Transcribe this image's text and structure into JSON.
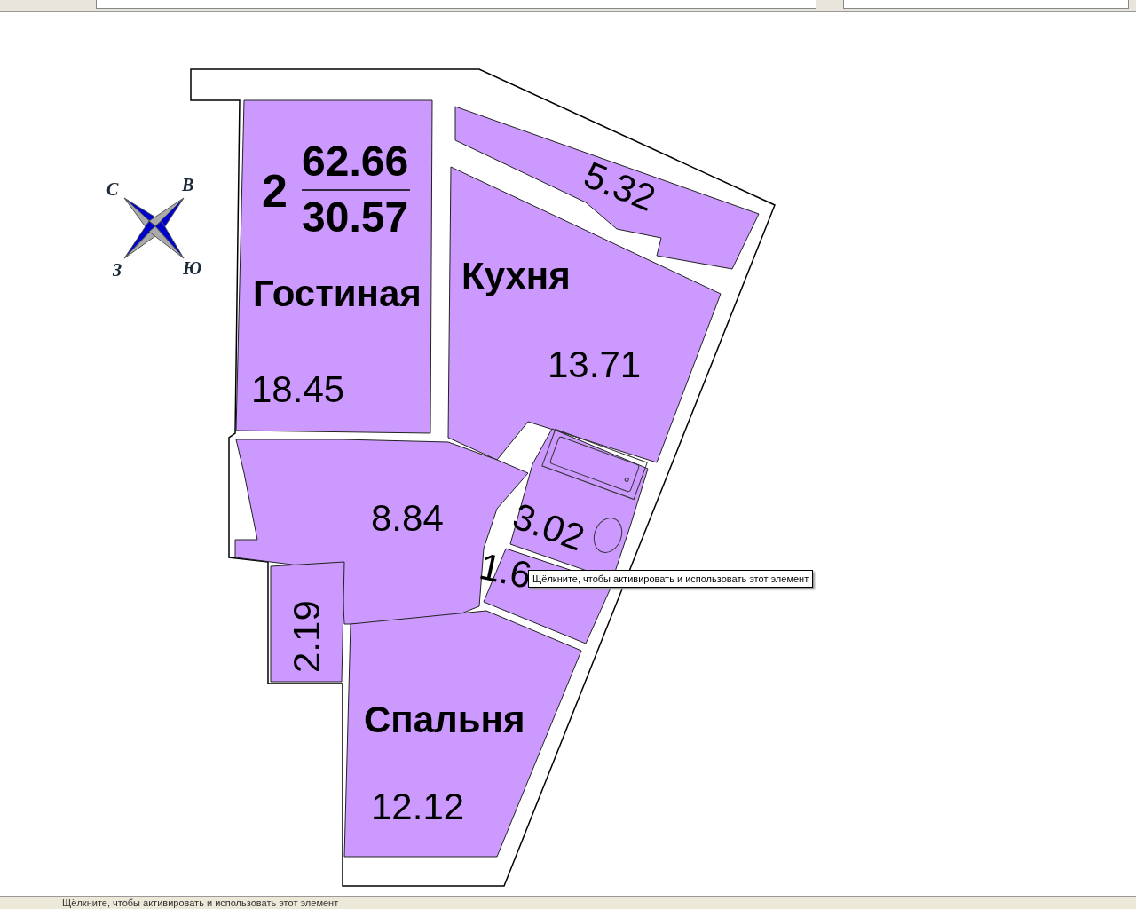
{
  "plan": {
    "rooms_count": "2",
    "total_area": "62.66",
    "living_area": "30.57",
    "rooms": [
      {
        "name": "Гостиная",
        "area": "18.45"
      },
      {
        "name": "Кухня",
        "area": "13.71"
      },
      {
        "area": "5.32"
      },
      {
        "area": "8.84"
      },
      {
        "area": "3.02"
      },
      {
        "area": "1.6"
      },
      {
        "area": "2.19"
      },
      {
        "name": "Спальня",
        "area": "12.12"
      }
    ],
    "compass": {
      "north": "С",
      "east": "В",
      "west": "З",
      "south": "Ю"
    }
  },
  "tooltip": "Щёлкните, чтобы активировать и использовать этот элемент",
  "status_bar": {
    "text": "Щёлкните, чтобы активировать и использовать этот элемент"
  }
}
